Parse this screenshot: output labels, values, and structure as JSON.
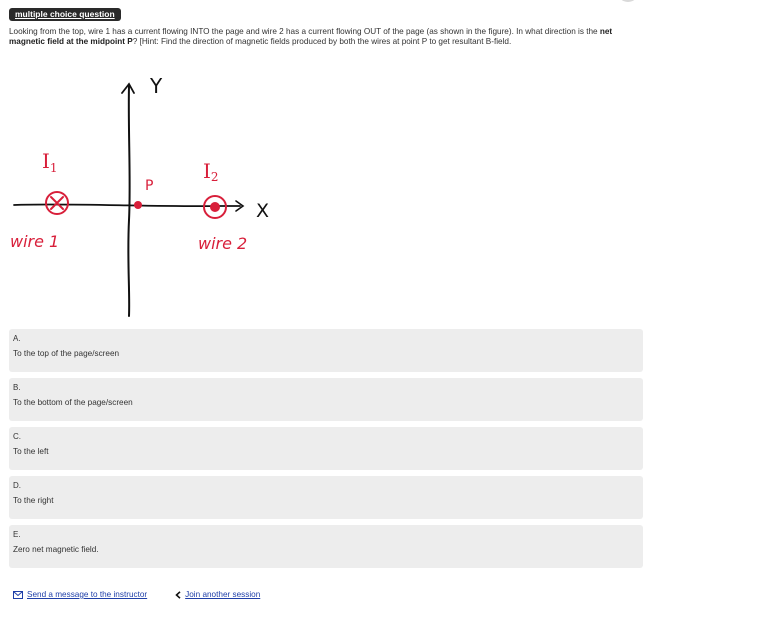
{
  "header": {
    "question_type": "multiple choice question"
  },
  "question": {
    "text_part1": "Looking from the top, wire 1 has a current flowing INTO the page and wire 2 has a current flowing OUT of the page (as shown in the figure).  In what direction is the ",
    "text_bold": "net magnetic field at the midpoint P",
    "text_part2": "? [Hint: Find the direction of magnetic fields produced by both the wires at point P to get resultant B-field."
  },
  "figure": {
    "y_label": "Y",
    "x_label": "X",
    "i1_label": "I",
    "i1_sub": "1",
    "i2_label": "I",
    "i2_sub": "2",
    "p_label": "P",
    "wire1_label": "wire 1",
    "wire2_label": "wire 2",
    "ink_color": "#111111",
    "wire_color": "#d81f3a"
  },
  "options": [
    {
      "letter": "A.",
      "text": "To the top of the page/screen"
    },
    {
      "letter": "B.",
      "text": "To the bottom of the page/screen"
    },
    {
      "letter": "C.",
      "text": "To the left"
    },
    {
      "letter": "D.",
      "text": "To the right"
    },
    {
      "letter": "E.",
      "text": "Zero net magnetic field."
    }
  ],
  "footer": {
    "message_link": "Send a message to the instructor",
    "join_link": "Join another session",
    "message_icon": "envelope-icon",
    "join_icon": "chevron-left-icon"
  },
  "colors": {
    "option_bg": "#ededed",
    "link": "#1f3fa8",
    "badge_bg": "#2a2a2a"
  }
}
